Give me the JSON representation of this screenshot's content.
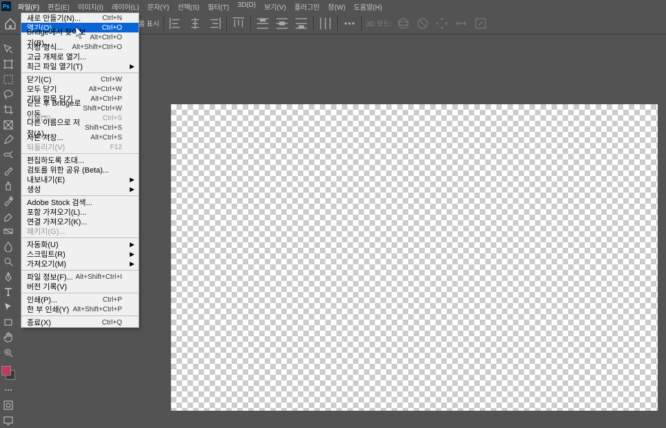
{
  "app": {
    "icon_label": "Ps"
  },
  "menubar": {
    "items": [
      "파일(F)",
      "편집(E)",
      "이미지(I)",
      "레이어(L)",
      "문자(Y)",
      "선택(S)",
      "필터(T)",
      "3D(D)",
      "보기(V)",
      "플러그인",
      "창(W)",
      "도움말(H)"
    ]
  },
  "options_bar": {
    "transform_label": "변형 컨트롤 표시",
    "mode3d_label": "3D 모드:"
  },
  "file_menu": {
    "items": [
      {
        "label": "새로 만들기(N)...",
        "shortcut": "Ctrl+N"
      },
      {
        "label": "열기(O)...",
        "shortcut": "Ctrl+O",
        "highlighted": true
      },
      {
        "label": "Bridge에서 찾아보기(B)...",
        "shortcut": "Alt+Ctrl+O"
      },
      {
        "label": "지정 형식...",
        "shortcut": "Alt+Shift+Ctrl+O"
      },
      {
        "label": "고급 개체로 열기..."
      },
      {
        "label": "최근 파일 열기(T)",
        "submenu": true
      },
      {
        "sep": true
      },
      {
        "label": "닫기(C)",
        "shortcut": "Ctrl+W"
      },
      {
        "label": "모두 닫기",
        "shortcut": "Alt+Ctrl+W"
      },
      {
        "label": "기타 항목 닫기",
        "shortcut": "Alt+Ctrl+P"
      },
      {
        "label": "닫은 후 Bridge로 이동...",
        "shortcut": "Shift+Ctrl+W"
      },
      {
        "label": "저장(S)",
        "shortcut": "Ctrl+S",
        "disabled": true
      },
      {
        "label": "다른 이름으로 저장(A)...",
        "shortcut": "Shift+Ctrl+S"
      },
      {
        "label": "사본 저장...",
        "shortcut": "Alt+Ctrl+S"
      },
      {
        "label": "되돌리기(V)",
        "shortcut": "F12",
        "disabled": true
      },
      {
        "sep": true
      },
      {
        "label": "편집하도록 초대..."
      },
      {
        "label": "검토를 위한 공유 (Beta)..."
      },
      {
        "label": "내보내기(E)",
        "submenu": true
      },
      {
        "label": "생성",
        "submenu": true
      },
      {
        "sep": true
      },
      {
        "label": "Adobe Stock 검색..."
      },
      {
        "label": "포함 가져오기(L)..."
      },
      {
        "label": "연결 가져오기(K)..."
      },
      {
        "label": "패키지(G)...",
        "disabled": true
      },
      {
        "sep": true
      },
      {
        "label": "자동화(U)",
        "submenu": true
      },
      {
        "label": "스크립트(R)",
        "submenu": true
      },
      {
        "label": "가져오기(M)",
        "submenu": true
      },
      {
        "sep": true
      },
      {
        "label": "파일 정보(F)...",
        "shortcut": "Alt+Shift+Ctrl+I"
      },
      {
        "label": "버전 기록(V)"
      },
      {
        "sep": true
      },
      {
        "label": "인쇄(P)...",
        "shortcut": "Ctrl+P"
      },
      {
        "label": "한 부 인쇄(Y)",
        "shortcut": "Alt+Shift+Ctrl+P"
      },
      {
        "sep": true
      },
      {
        "label": "종료(X)",
        "shortcut": "Ctrl+Q"
      }
    ]
  },
  "tools": [
    "move-tool",
    "artboard-tool",
    "marquee-tool",
    "lasso-tool",
    "crop-tool",
    "frame-tool",
    "eyedropper-tool",
    "spot-heal-tool",
    "brush-tool",
    "clone-tool",
    "history-brush-tool",
    "eraser-tool",
    "gradient-tool",
    "blur-tool",
    "dodge-tool",
    "pen-tool",
    "type-tool",
    "path-select-tool",
    "rectangle-tool",
    "hand-tool",
    "zoom-tool"
  ],
  "tool_extras": [
    "edit-toolbar-icon",
    "quick-mask-icon",
    "screen-mode-icon"
  ]
}
